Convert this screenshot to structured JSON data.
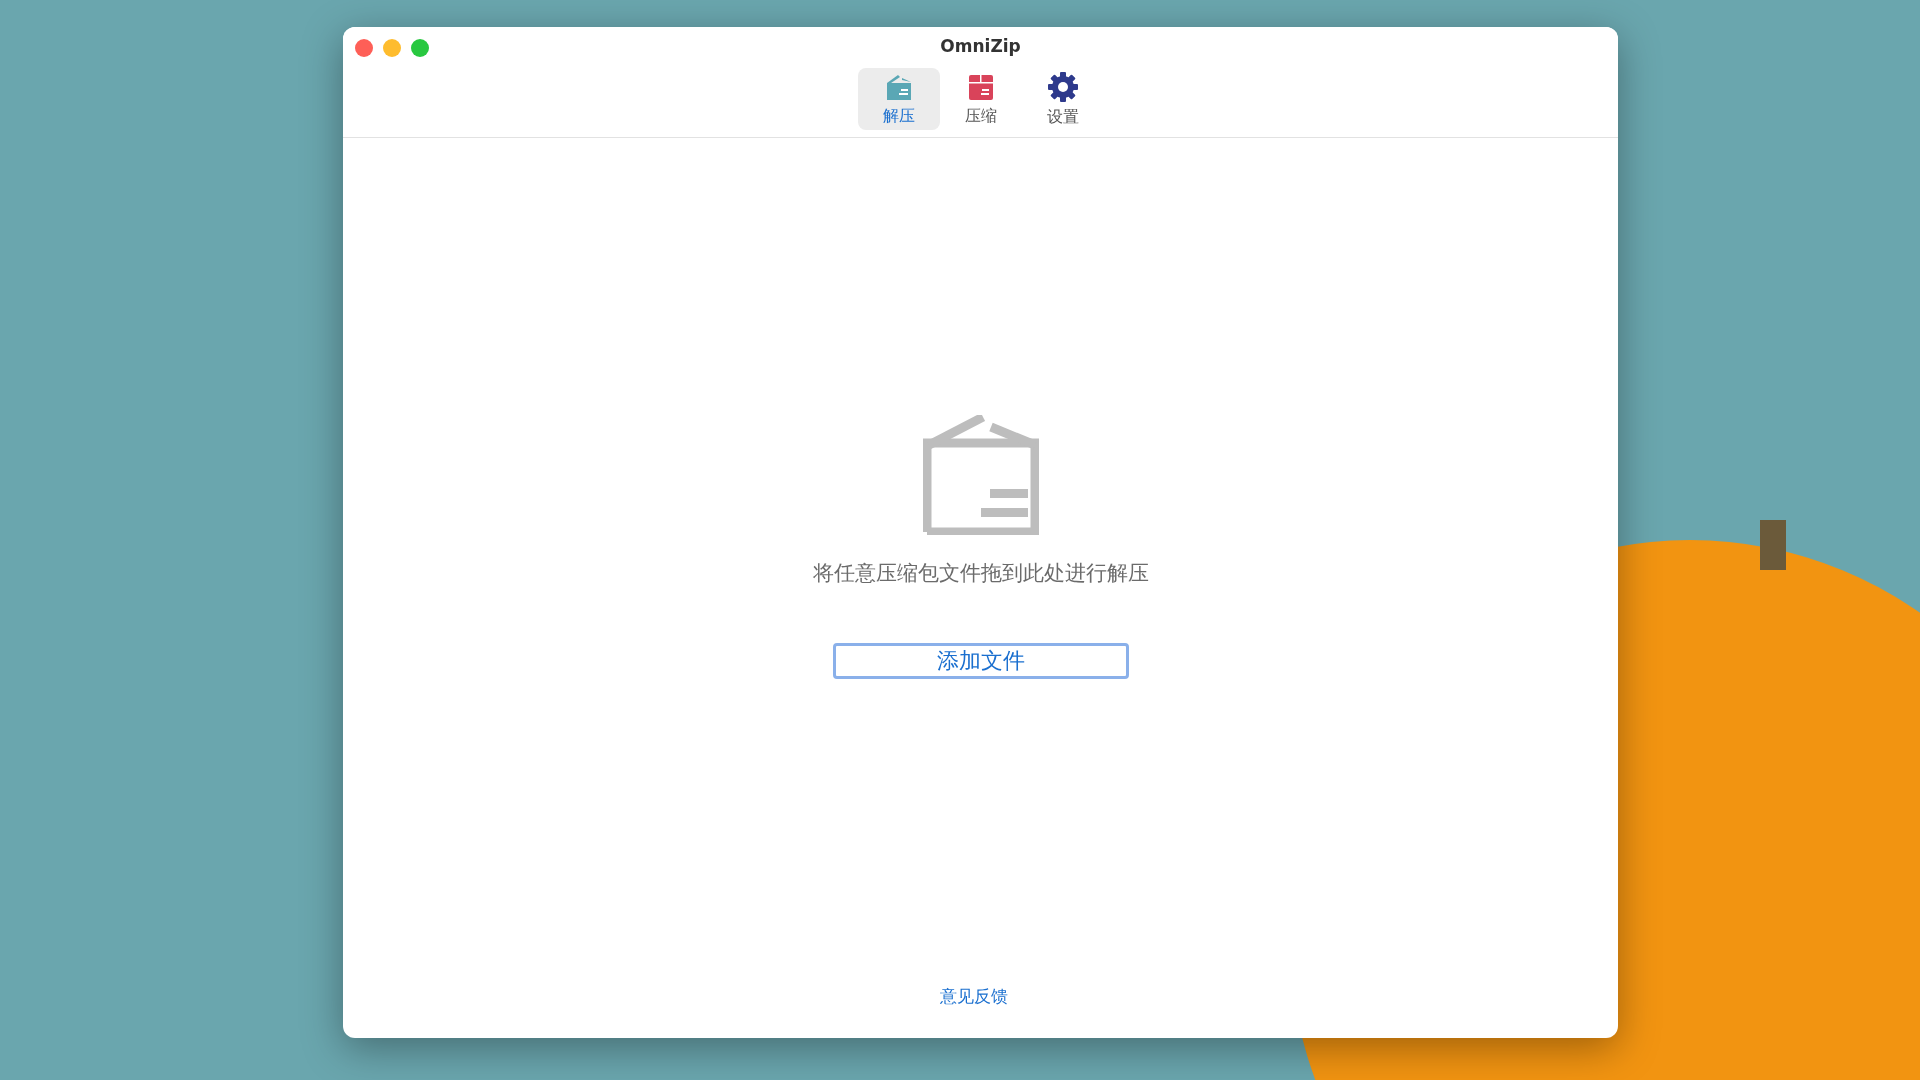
{
  "window": {
    "title": "OmniZip"
  },
  "tabs": [
    {
      "label": "解压",
      "kind": "extract",
      "selected": true
    },
    {
      "label": "压缩",
      "kind": "compress",
      "selected": false
    },
    {
      "label": "设置",
      "kind": "settings",
      "selected": false
    }
  ],
  "drop_zone": {
    "hint": "将任意压缩包文件拖到此处进行解压",
    "button": "添加文件"
  },
  "footer_link": "意见反馈"
}
